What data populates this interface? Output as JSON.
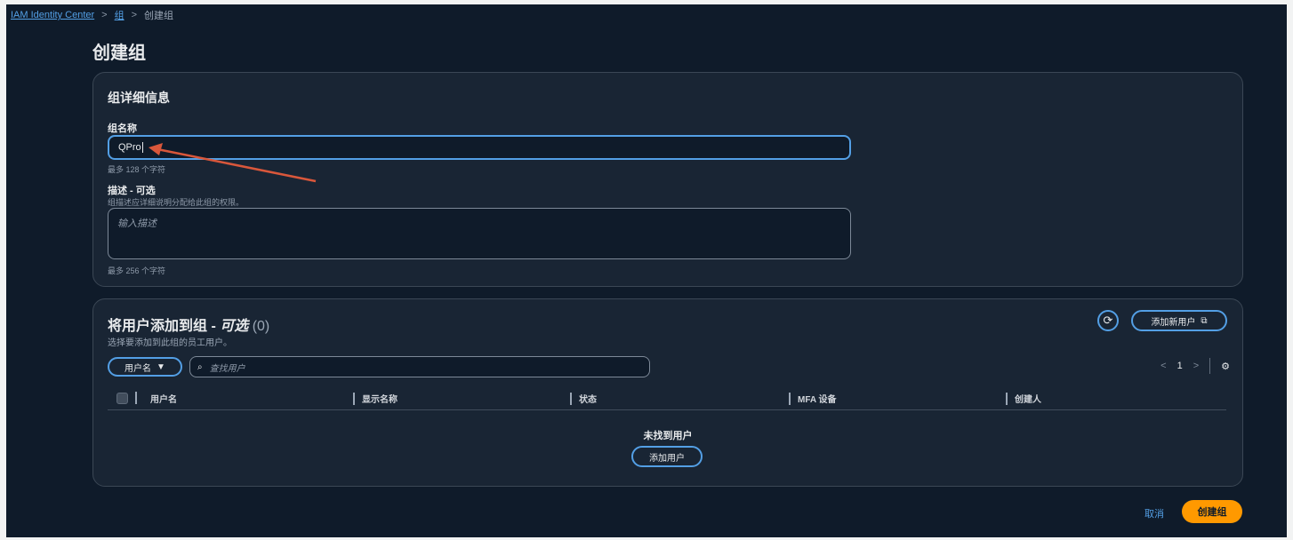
{
  "breadcrumb": {
    "root": "IAM Identity Center",
    "parent": "组",
    "current": "创建组",
    "separator": ">"
  },
  "page": {
    "title": "创建组"
  },
  "details": {
    "title": "组详细信息",
    "name_label": "组名称",
    "name_value": "QPro",
    "name_hint": "最多 128 个字符",
    "desc_label": "描述 - 可选",
    "desc_help": "组描述应详细说明分配给此组的权限。",
    "desc_placeholder": "输入描述",
    "desc_hint": "最多 256 个字符"
  },
  "members": {
    "title_prefix": "将用户添加到组 - ",
    "title_optional": "可选",
    "title_count": "(0)",
    "subtitle": "选择要添加到此组的员工用户。",
    "refresh_icon": "refresh-icon",
    "add_new_user_label": "添加新用户",
    "external_icon": "external-link-icon",
    "filter_label": "用户名",
    "search_placeholder": "查找用户",
    "pager": {
      "prev": "<",
      "page": "1",
      "next": ">"
    },
    "settings_icon": "gear-icon",
    "columns": [
      "用户名",
      "显示名称",
      "状态",
      "MFA 设备",
      "创建人"
    ],
    "empty_title": "未找到用户",
    "empty_button": "添加用户"
  },
  "footer": {
    "cancel": "取消",
    "create": "创建组"
  },
  "colors": {
    "background": "#0f1b2a",
    "card": "#192534",
    "accent": "#539fe5",
    "primary": "#ff9900",
    "annotation_arrow": "#d9573b"
  }
}
